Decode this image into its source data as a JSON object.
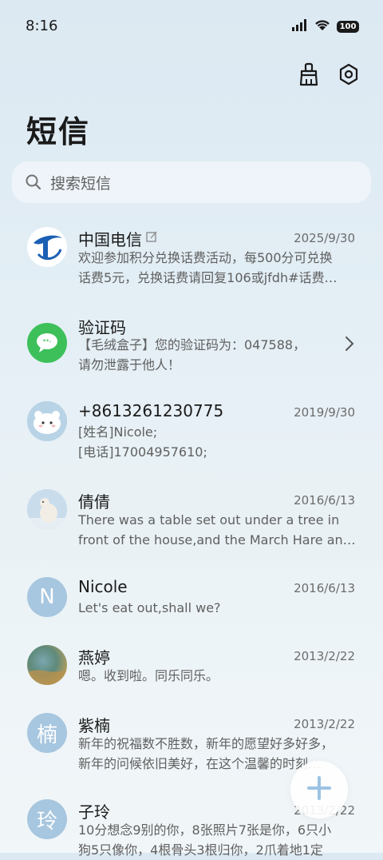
{
  "status": {
    "time": "8:16",
    "battery": "100"
  },
  "header": {
    "title": "短信"
  },
  "search": {
    "placeholder": "搜索短信"
  },
  "messages": [
    {
      "name": "中国电信",
      "date": "2025/9/30",
      "line1": "欢迎参加积分兑换话费活动，每500分可兑换",
      "line2": "话费5元，兑换话费请回复106或jfdh#话费…"
    },
    {
      "name": "验证码",
      "date": "",
      "line1": "【毛绒盒子】您的验证码为：047588，",
      "line2": "请勿泄露于他人！"
    },
    {
      "name": "+8613261230775",
      "date": "2019/9/30",
      "line1": "[姓名]Nicole;",
      "line2": "[电话]17004957610;"
    },
    {
      "name": "倩倩",
      "date": "2016/6/13",
      "line1": "There was a table set out under a tree in",
      "line2": "front of the house,and the March Hare an…"
    },
    {
      "name": "Nicole",
      "avatar_letter": "N",
      "date": "2016/6/13",
      "line1": "Let's eat out,shall we?"
    },
    {
      "name": "燕婷",
      "date": "2013/2/22",
      "line1": "嗯。收到啦。同乐同乐。"
    },
    {
      "name": "紫楠",
      "avatar_letter": "楠",
      "date": "2013/2/22",
      "line1": "新年的祝福数不胜数，新年的愿望好多好多，",
      "line2": "新年的问候依旧美好，在这个温馨的时刻…"
    },
    {
      "name": "子玲",
      "avatar_letter": "玲",
      "date": "2013/2/22",
      "line1": "10分想念9别的你，8张照片7张是你，6只小",
      "line2": "狗5只像你，4根骨头3根归你，2爪着地1定"
    }
  ],
  "colors": {
    "accent": "#a7c6df",
    "brand_telecom": "#1a5fb4",
    "sms_green": "#3dc05a"
  }
}
